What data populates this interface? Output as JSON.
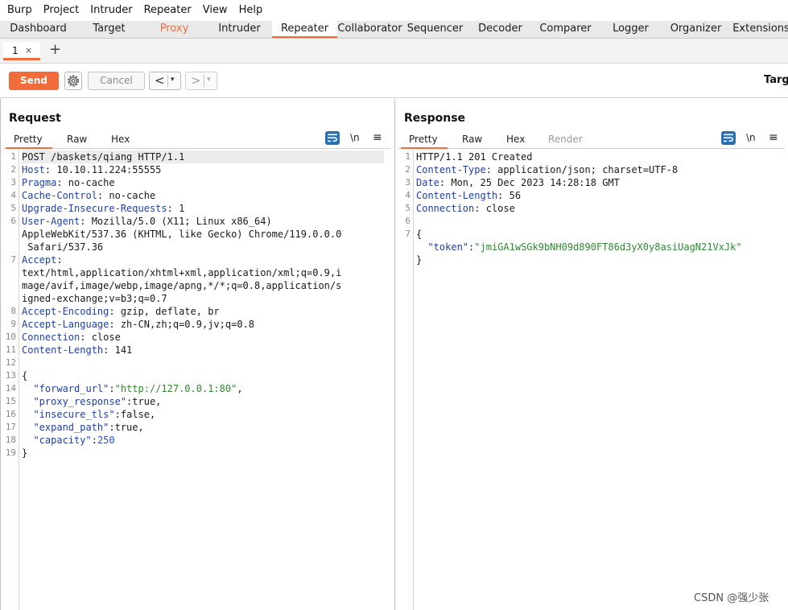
{
  "menubar": {
    "items": [
      "Burp",
      "Project",
      "Intruder",
      "Repeater",
      "View",
      "Help"
    ]
  },
  "top_tabs": [
    "Dashboard",
    "Target",
    "Proxy",
    "Intruder",
    "Repeater",
    "Collaborator",
    "Sequencer",
    "Decoder",
    "Comparer",
    "Logger",
    "Organizer",
    "Extensions"
  ],
  "active_top_tab": "Repeater",
  "repeater_tab": {
    "label": "1",
    "close": "×",
    "add": "+"
  },
  "toolbar": {
    "send": "Send",
    "cancel": "Cancel",
    "back": "<",
    "forward": ">",
    "dropdown": "▾",
    "target": "Target"
  },
  "request": {
    "title": "Request",
    "tabs": [
      "Pretty",
      "Raw",
      "Hex"
    ],
    "newline_label": "\\n",
    "menu_label": "≡",
    "lines": [
      {
        "n": "1",
        "segments": [
          [
            "POST /baskets/qiang HTTP/1.1",
            ""
          ]
        ]
      },
      {
        "n": "2",
        "segments": [
          [
            "Host",
            "k"
          ],
          [
            ": 10.10.11.224:55555",
            ""
          ]
        ]
      },
      {
        "n": "3",
        "segments": [
          [
            "Pragma",
            "k"
          ],
          [
            ": no-cache",
            ""
          ]
        ]
      },
      {
        "n": "4",
        "segments": [
          [
            "Cache-Control",
            "k"
          ],
          [
            ": no-cache",
            ""
          ]
        ]
      },
      {
        "n": "5",
        "segments": [
          [
            "Upgrade-Insecure-Requests",
            "k"
          ],
          [
            ": 1",
            ""
          ]
        ]
      },
      {
        "n": "6",
        "segments": [
          [
            "User-Agent",
            "k"
          ],
          [
            ": Mozilla/5.0 (X11; Linux x86_64)",
            ""
          ]
        ]
      },
      {
        "n": "",
        "segments": [
          [
            "AppleWebKit/537.36 (KHTML, like Gecko) Chrome/119.0.0.0",
            ""
          ]
        ]
      },
      {
        "n": "",
        "segments": [
          [
            " Safari/537.36",
            ""
          ]
        ]
      },
      {
        "n": "7",
        "segments": [
          [
            "Accept",
            "k"
          ],
          [
            ":",
            ""
          ]
        ]
      },
      {
        "n": "",
        "segments": [
          [
            "text/html,application/xhtml+xml,application/xml;q=0.9,i",
            ""
          ]
        ]
      },
      {
        "n": "",
        "segments": [
          [
            "mage/avif,image/webp,image/apng,*/*;q=0.8,application/s",
            ""
          ]
        ]
      },
      {
        "n": "",
        "segments": [
          [
            "igned-exchange;v=b3;q=0.7",
            ""
          ]
        ]
      },
      {
        "n": "8",
        "segments": [
          [
            "Accept-Encoding",
            "k"
          ],
          [
            ": gzip, deflate, br",
            ""
          ]
        ]
      },
      {
        "n": "9",
        "segments": [
          [
            "Accept-Language",
            "k"
          ],
          [
            ": zh-CN,zh;q=0.9,jv;q=0.8",
            ""
          ]
        ]
      },
      {
        "n": "10",
        "segments": [
          [
            "Connection",
            "k"
          ],
          [
            ": close",
            ""
          ]
        ]
      },
      {
        "n": "11",
        "segments": [
          [
            "Content-Length",
            "k"
          ],
          [
            ": 141",
            ""
          ]
        ]
      },
      {
        "n": "12",
        "segments": []
      },
      {
        "n": "13",
        "segments": [
          [
            "{",
            ""
          ]
        ]
      },
      {
        "n": "14",
        "segments": [
          [
            "  ",
            ""
          ],
          [
            "\"forward_url\"",
            "k"
          ],
          [
            ":",
            ""
          ],
          [
            "\"http://127.0.0.1:80\"",
            "s"
          ],
          [
            ",",
            ""
          ]
        ]
      },
      {
        "n": "15",
        "segments": [
          [
            "  ",
            ""
          ],
          [
            "\"proxy_response\"",
            "k"
          ],
          [
            ":true,",
            ""
          ]
        ]
      },
      {
        "n": "16",
        "segments": [
          [
            "  ",
            ""
          ],
          [
            "\"insecure_tls\"",
            "k"
          ],
          [
            ":false,",
            ""
          ]
        ]
      },
      {
        "n": "17",
        "segments": [
          [
            "  ",
            ""
          ],
          [
            "\"expand_path\"",
            "k"
          ],
          [
            ":true,",
            ""
          ]
        ]
      },
      {
        "n": "18",
        "segments": [
          [
            "  ",
            ""
          ],
          [
            "\"capacity\"",
            "k"
          ],
          [
            ":",
            ""
          ],
          [
            "250",
            "n"
          ]
        ]
      },
      {
        "n": "19",
        "segments": [
          [
            "}",
            ""
          ]
        ]
      }
    ]
  },
  "response": {
    "title": "Response",
    "tabs": [
      "Pretty",
      "Raw",
      "Hex",
      "Render"
    ],
    "newline_label": "\\n",
    "menu_label": "≡",
    "lines": [
      {
        "n": "1",
        "segments": [
          [
            "HTTP/1.1 201 Created",
            ""
          ]
        ]
      },
      {
        "n": "2",
        "segments": [
          [
            "Content-Type",
            "k"
          ],
          [
            ": application/json; charset=UTF-8",
            ""
          ]
        ]
      },
      {
        "n": "3",
        "segments": [
          [
            "Date",
            "k"
          ],
          [
            ": Mon, 25 Dec 2023 14:28:18 GMT",
            ""
          ]
        ]
      },
      {
        "n": "4",
        "segments": [
          [
            "Content-Length",
            "k"
          ],
          [
            ": 56",
            ""
          ]
        ]
      },
      {
        "n": "5",
        "segments": [
          [
            "Connection",
            "k"
          ],
          [
            ": close",
            ""
          ]
        ]
      },
      {
        "n": "6",
        "segments": []
      },
      {
        "n": "7",
        "segments": [
          [
            "{",
            ""
          ]
        ]
      },
      {
        "n": "",
        "segments": [
          [
            "  ",
            ""
          ],
          [
            "\"token\"",
            "k"
          ],
          [
            ":",
            ""
          ],
          [
            "\"jmiGA1wSGk9bNH09d890FT86d3yX0y8asiUagN21VxJk\"",
            "s"
          ]
        ]
      },
      {
        "n": "",
        "segments": [
          [
            "}",
            ""
          ]
        ]
      }
    ]
  },
  "watermark": "CSDN @强少张",
  "colors": {
    "accent": "#f26b3a",
    "header_key": "#1f3fa6",
    "string": "#2e8b2e",
    "number": "#2b4dbf",
    "toggle_active": "#2b6fb0"
  }
}
